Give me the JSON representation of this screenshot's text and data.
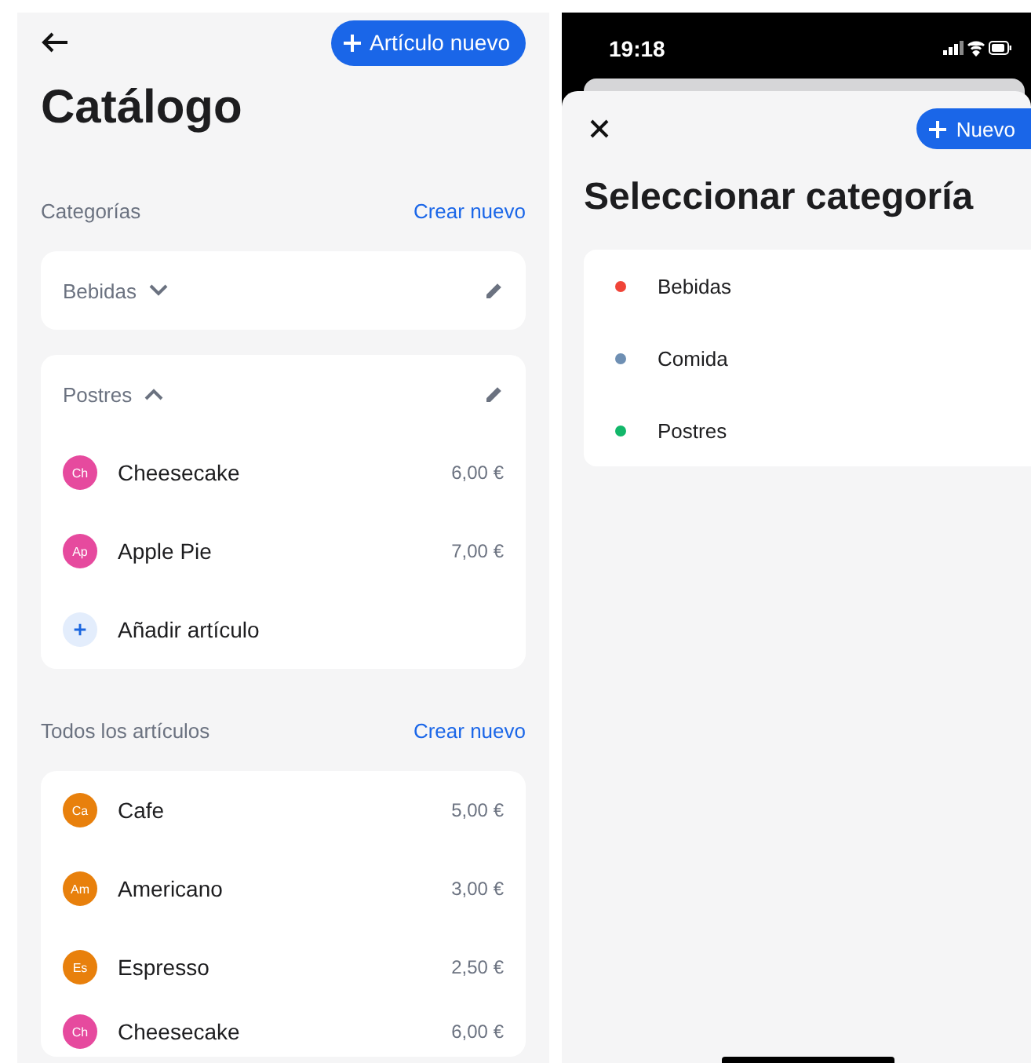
{
  "catalog": {
    "new_item_button": "Artículo nuevo",
    "title": "Catálogo",
    "categories_section": {
      "label": "Categorías",
      "action": "Crear nuevo"
    },
    "categories": [
      {
        "name": "Bebidas",
        "expanded": false
      },
      {
        "name": "Postres",
        "expanded": true,
        "items": [
          {
            "initials": "Ch",
            "name": "Cheesecake",
            "price": "6,00 €",
            "color": "#e64a9e"
          },
          {
            "initials": "Ap",
            "name": "Apple Pie",
            "price": "7,00 €",
            "color": "#e64a9e"
          }
        ],
        "add_label": "Añadir artículo"
      }
    ],
    "all_section": {
      "label": "Todos los artículos",
      "action": "Crear nuevo"
    },
    "all_items": [
      {
        "initials": "Ca",
        "name": "Cafe",
        "price": "5,00 €",
        "color": "#e8800c"
      },
      {
        "initials": "Am",
        "name": "Americano",
        "price": "3,00 €",
        "color": "#e8800c"
      },
      {
        "initials": "Es",
        "name": "Espresso",
        "price": "2,50 €",
        "color": "#e8800c"
      },
      {
        "initials": "Ch",
        "name": "Cheesecake",
        "price": "6,00 €",
        "color": "#e64a9e"
      }
    ]
  },
  "picker": {
    "status_time": "19:18",
    "new_button": "Nuevo",
    "title": "Seleccionar categoría",
    "categories": [
      {
        "name": "Bebidas",
        "color": "#f04438"
      },
      {
        "name": "Comida",
        "color": "#6e8fb3"
      },
      {
        "name": "Postres",
        "color": "#12b76a"
      }
    ]
  }
}
